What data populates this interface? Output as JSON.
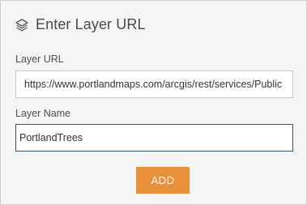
{
  "dialog": {
    "title": "Enter Layer URL",
    "icon": "layers-icon"
  },
  "layer_url": {
    "label": "Layer URL",
    "value": "https://www.portlandmaps.com/arcgis/rest/services/Public"
  },
  "layer_name": {
    "label": "Layer Name",
    "value": "PortlandTrees"
  },
  "actions": {
    "add_label": "ADD"
  },
  "colors": {
    "accent": "#e8903a",
    "focus_border": "#2e5573",
    "panel_bg": "#f5f5f5"
  }
}
